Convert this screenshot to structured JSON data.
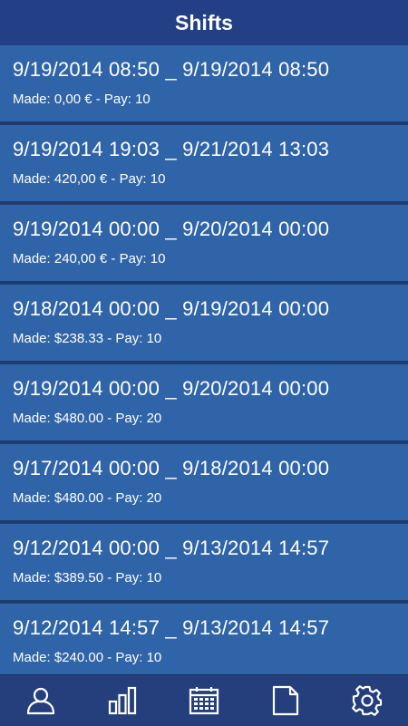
{
  "header": {
    "title": "Shifts"
  },
  "shifts": [
    {
      "range": "9/19/2014 08:50 _ 9/19/2014 08:50",
      "detail": "Made: 0,00 € - Pay: 10"
    },
    {
      "range": "9/19/2014 19:03 _ 9/21/2014 13:03",
      "detail": "Made: 420,00 € - Pay: 10"
    },
    {
      "range": "9/19/2014 00:00 _ 9/20/2014 00:00",
      "detail": "Made: 240,00 € - Pay: 10"
    },
    {
      "range": "9/18/2014 00:00 _ 9/19/2014 00:00",
      "detail": "Made: $238.33 - Pay: 10"
    },
    {
      "range": "9/19/2014 00:00 _ 9/20/2014 00:00",
      "detail": "Made: $480.00 - Pay: 20"
    },
    {
      "range": "9/17/2014 00:00 _ 9/18/2014 00:00",
      "detail": "Made: $480.00 - Pay: 20"
    },
    {
      "range": "9/12/2014 00:00 _ 9/13/2014 14:57",
      "detail": "Made: $389.50 - Pay: 10"
    },
    {
      "range": "9/12/2014 14:57 _ 9/13/2014 14:57",
      "detail": "Made: $240.00 - Pay: 10"
    }
  ],
  "tabbar": {
    "tabs": [
      {
        "icon": "profile-icon"
      },
      {
        "icon": "bar-chart-icon"
      },
      {
        "icon": "calendar-icon"
      },
      {
        "icon": "document-icon"
      },
      {
        "icon": "gear-icon"
      }
    ]
  },
  "colors": {
    "header": "#233f85",
    "row": "#3064a8",
    "separator": "#1f3c6e",
    "tabbar": "#253f7d",
    "text": "#ffffff"
  }
}
